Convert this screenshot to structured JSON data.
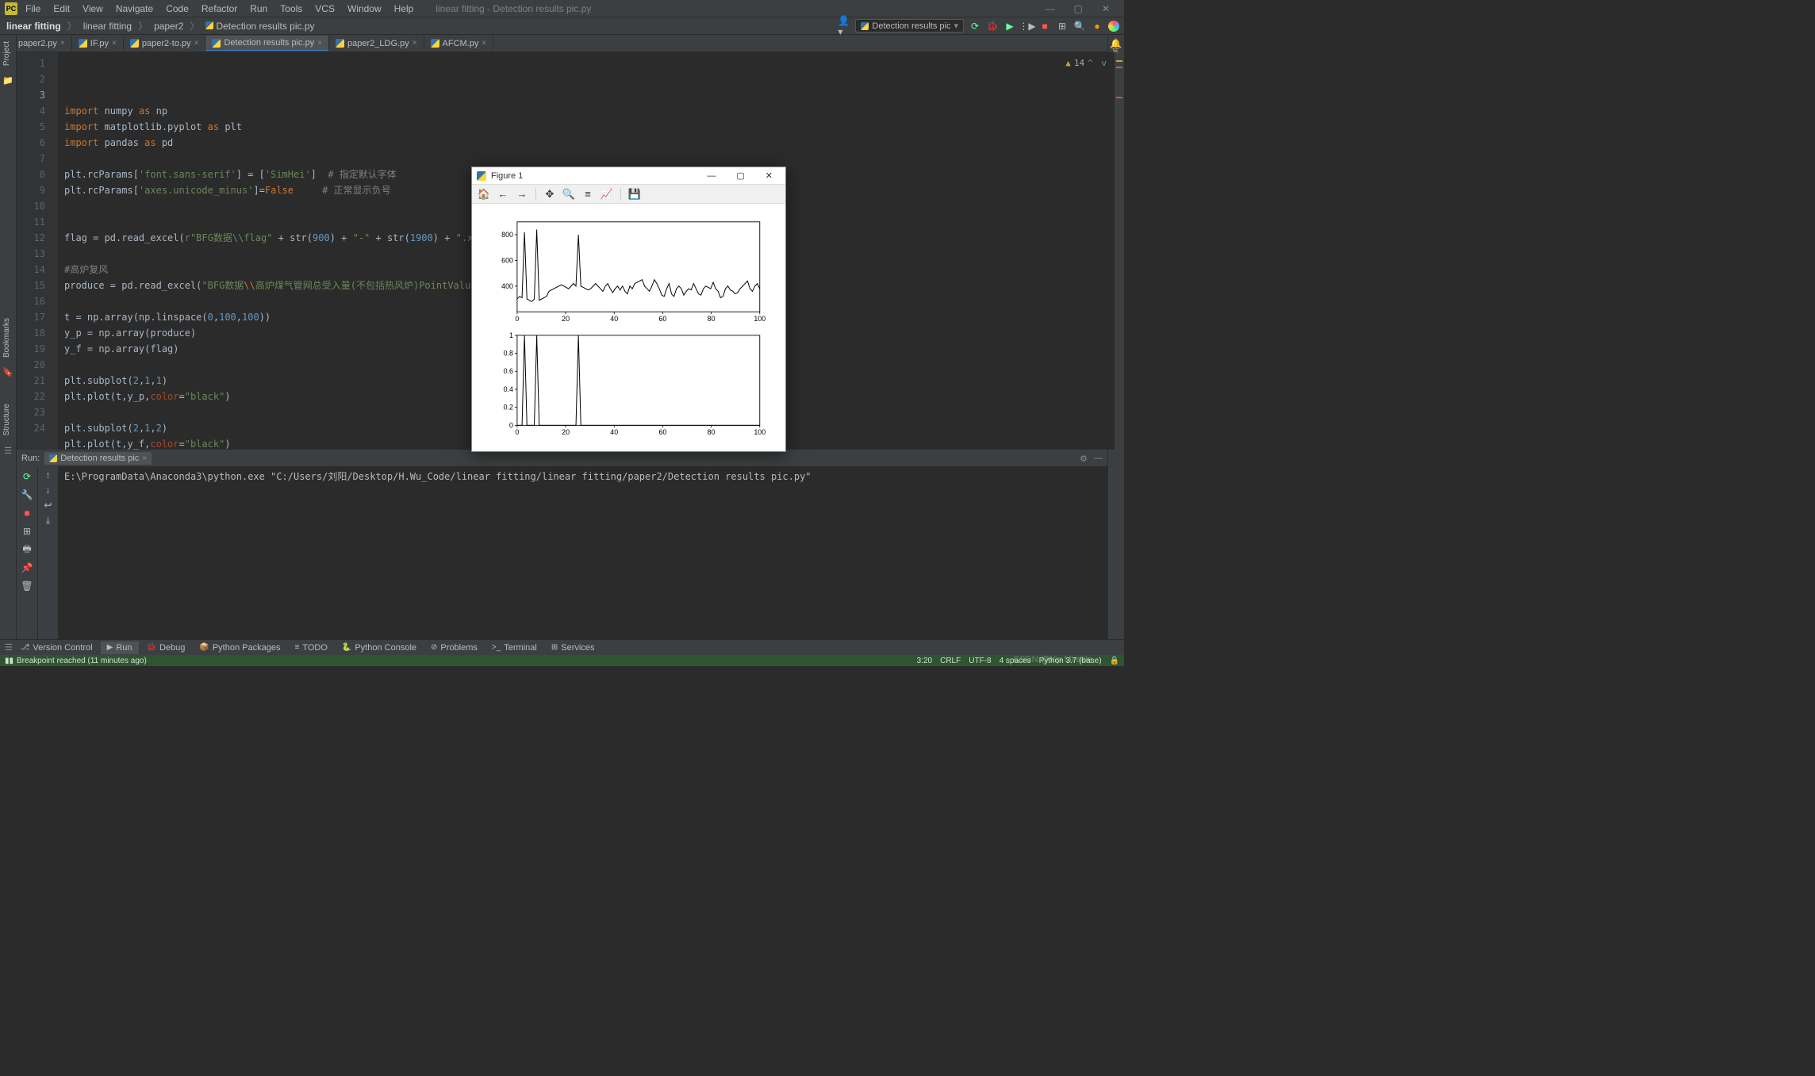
{
  "app_title": "linear fitting - Detection results pic.py",
  "menu": [
    "File",
    "Edit",
    "View",
    "Navigate",
    "Code",
    "Refactor",
    "Run",
    "Tools",
    "VCS",
    "Window",
    "Help"
  ],
  "breadcrumb": [
    "linear fitting",
    "linear fitting",
    "paper2",
    "Detection results pic.py"
  ],
  "run_config": {
    "label": "Detection results pic"
  },
  "editor_tabs": [
    {
      "label": "paper2.py",
      "active": false
    },
    {
      "label": "IF.py",
      "active": false
    },
    {
      "label": "paper2-to.py",
      "active": false
    },
    {
      "label": "Detection results pic.py",
      "active": true
    },
    {
      "label": "paper2_LDG.py",
      "active": false
    },
    {
      "label": "AFCM.py",
      "active": false
    }
  ],
  "warnings_count": "14",
  "code_lines": [
    {
      "n": 1,
      "html": "<span class='kw'>import</span> numpy <span class='kw'>as</span> np"
    },
    {
      "n": 2,
      "html": "<span class='kw'>import</span> matplotlib.pyplot <span class='kw'>as</span> plt"
    },
    {
      "n": 3,
      "html": "<span class='kw'>import</span> pandas <span class='kw'>as</span> pd"
    },
    {
      "n": 4,
      "html": ""
    },
    {
      "n": 5,
      "html": "plt.rcParams[<span class='str'>'font.sans-serif'</span>] = [<span class='str'>'SimHei'</span>]  <span class='com'># 指定默认字体</span>"
    },
    {
      "n": 6,
      "html": "plt.rcParams[<span class='str'>'axes.unicode_minus'</span>]=<span class='kw'>False</span>     <span class='com'># 正常显示负号</span>"
    },
    {
      "n": 7,
      "html": ""
    },
    {
      "n": 8,
      "html": ""
    },
    {
      "n": 9,
      "html": "flag = pd.read_excel(<span class='str'>r\"BFG数据\\\\flag\"</span> + str(<span class='num'>900</span>) + <span class='str'>\"-\"</span> + str(<span class='num'>1900</span>) + <span class='str'>\".xlsx\"</span>,"
    },
    {
      "n": 10,
      "html": ""
    },
    {
      "n": 11,
      "html": "<span class='com'>#高炉复风</span>"
    },
    {
      "n": 12,
      "html": "produce = pd.read_excel(<span class='str'>\"BFG数据<span style='color:#cc7832'>\\\\</span>高炉煤气管网总受入量(不包括热风炉)PointValue.xls\"</span>"
    },
    {
      "n": 13,
      "html": ""
    },
    {
      "n": 14,
      "html": "t = np.array(np.linspace(<span class='num'>0</span>,<span class='num'>100</span>,<span class='num'>100</span>))"
    },
    {
      "n": 15,
      "html": "y_p = np.array(produce)"
    },
    {
      "n": 16,
      "html": "y_f = np.array(flag)"
    },
    {
      "n": 17,
      "html": ""
    },
    {
      "n": 18,
      "html": "plt.subplot(<span class='num'>2</span>,<span class='num'>1</span>,<span class='num'>1</span>)"
    },
    {
      "n": 19,
      "html": "plt.plot(t,y_p,<span class='param'>color</span>=<span class='str'>\"black\"</span>)"
    },
    {
      "n": 20,
      "html": ""
    },
    {
      "n": 21,
      "html": "plt.subplot(<span class='num'>2</span>,<span class='num'>1</span>,<span class='num'>2</span>)"
    },
    {
      "n": 22,
      "html": "plt.plot(t,y_f,<span class='param'>color</span>=<span class='str'>\"black\"</span>)"
    },
    {
      "n": 23,
      "html": ""
    },
    {
      "n": 24,
      "html": ""
    }
  ],
  "run_tab": {
    "title": "Run:",
    "file": "Detection results pic"
  },
  "run_output": "E:\\ProgramData\\Anaconda3\\python.exe \"C:/Users/刘阳/Desktop/H.Wu_Code/linear fitting/linear fitting/paper2/Detection results pic.py\"",
  "bottom_tabs": [
    {
      "icon": "⎇",
      "label": "Version Control"
    },
    {
      "icon": "▶",
      "label": "Run",
      "active": true
    },
    {
      "icon": "🐞",
      "label": "Debug"
    },
    {
      "icon": "📦",
      "label": "Python Packages"
    },
    {
      "icon": "≡",
      "label": "TODO"
    },
    {
      "icon": "🐍",
      "label": "Python Console"
    },
    {
      "icon": "⊘",
      "label": "Problems"
    },
    {
      "icon": ">_",
      "label": "Terminal"
    },
    {
      "icon": "⊞",
      "label": "Services"
    }
  ],
  "left_tabs": [
    "Project",
    "Bookmarks",
    "Structure"
  ],
  "right_tabs": [
    "Notifications"
  ],
  "status": {
    "left": "Breakpoint reached (11 minutes ago)",
    "right": [
      "3:20",
      "CRLF",
      "UTF-8",
      "4 spaces",
      "Python 3.7 (base)"
    ]
  },
  "figure": {
    "title": "Figure 1",
    "toolbar_icons": [
      "home-icon",
      "back-icon",
      "forward-icon",
      "pan-icon",
      "zoom-icon",
      "configure-icon",
      "axes-icon",
      "save-icon"
    ]
  },
  "chart_data": [
    {
      "type": "line",
      "x_range": [
        0,
        100
      ],
      "y_range": [
        200,
        900
      ],
      "y_ticks": [
        400,
        600,
        800
      ],
      "x_ticks": [
        0,
        20,
        40,
        60,
        80,
        100
      ],
      "values": [
        300,
        320,
        310,
        820,
        300,
        290,
        280,
        300,
        840,
        290,
        300,
        310,
        320,
        360,
        370,
        380,
        390,
        400,
        410,
        400,
        390,
        380,
        400,
        420,
        400,
        800,
        400,
        390,
        380,
        370,
        380,
        400,
        420,
        400,
        380,
        360,
        400,
        420,
        380,
        350,
        380,
        400,
        370,
        400,
        360,
        340,
        400,
        380,
        420,
        430,
        440,
        450,
        400,
        380,
        360,
        400,
        450,
        420,
        380,
        330,
        320,
        380,
        420,
        340,
        320,
        380,
        400,
        380,
        330,
        360,
        380,
        370,
        420,
        380,
        340,
        330,
        380,
        400,
        390,
        380,
        430,
        380,
        360,
        310,
        320,
        380,
        400,
        370,
        360,
        340,
        350,
        380,
        400,
        420,
        440,
        380,
        360,
        400,
        420,
        380
      ]
    },
    {
      "type": "line",
      "x_range": [
        0,
        100
      ],
      "y_range": [
        0,
        1.0
      ],
      "y_ticks": [
        0.0,
        0.2,
        0.4,
        0.6,
        0.8,
        1.0
      ],
      "x_ticks": [
        0,
        20,
        40,
        60,
        80,
        100
      ],
      "values": [
        0,
        0,
        0,
        1,
        0,
        0,
        0,
        0,
        1,
        0,
        0,
        0,
        0,
        0,
        0,
        0,
        0,
        0,
        0,
        0,
        0,
        0,
        0,
        0,
        0,
        1,
        0,
        0,
        0,
        0,
        0,
        0,
        0,
        0,
        0,
        0,
        0,
        0,
        0,
        0,
        0,
        0,
        0,
        0,
        0,
        0,
        0,
        0,
        0,
        0,
        0,
        0,
        0,
        0,
        0,
        0,
        0,
        0,
        0,
        0,
        0,
        0,
        0,
        0,
        0,
        0,
        0,
        0,
        0,
        0,
        0,
        0,
        0,
        0,
        0,
        0,
        0,
        0,
        0,
        0,
        0,
        0,
        0,
        0,
        0,
        0,
        0,
        0,
        0,
        0,
        0,
        0,
        0,
        0,
        0,
        0,
        0,
        0,
        0,
        0
      ]
    }
  ],
  "watermark": "CSDN @Vip Miracle"
}
